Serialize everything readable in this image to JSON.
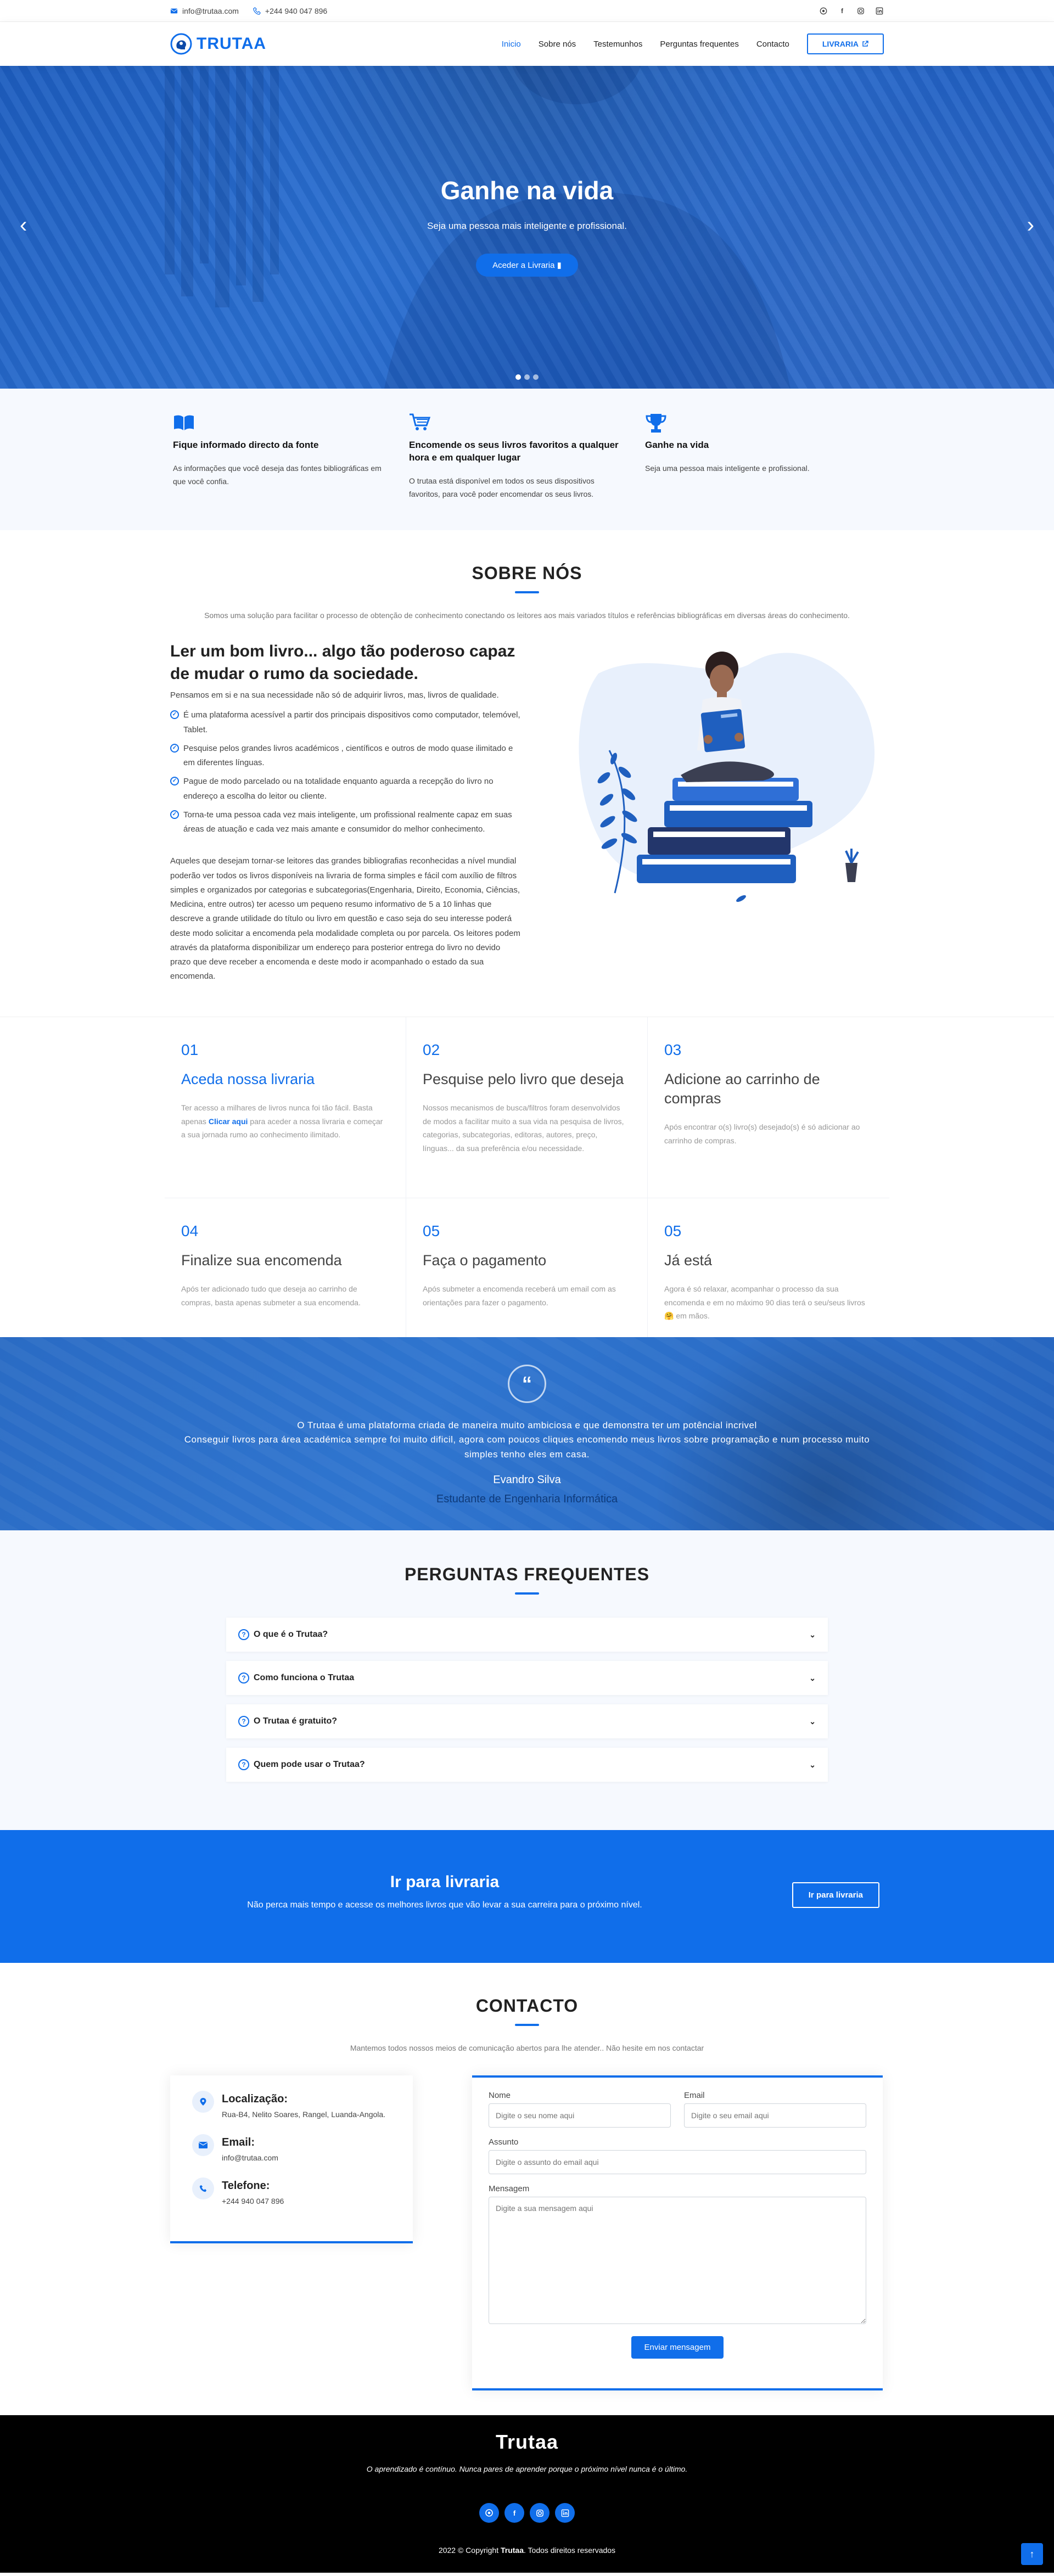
{
  "topbar": {
    "email": "info@trutaa.com",
    "phone": "+244 940 047 896",
    "social_icons": [
      "whatsapp-icon",
      "facebook-icon",
      "instagram-icon",
      "linkedin-icon"
    ]
  },
  "header": {
    "brand": "TRUTAA",
    "nav": [
      "Inicio",
      "Sobre nós",
      "Testemunhos",
      "Perguntas frequentes",
      "Contacto"
    ],
    "active_nav": "Inicio",
    "cta": "LIVRARIA"
  },
  "hero": {
    "title": "Ganhe na vida",
    "subtitle": "Seja uma pessoa mais inteligente e profissional.",
    "button": "Aceder a Livraria",
    "slides": 3,
    "active_slide": 1
  },
  "features": [
    {
      "icon": "book-icon",
      "title": "Fique informado directo da fonte",
      "text": "As informações que você deseja das fontes bibliográficas em que você confia."
    },
    {
      "icon": "cart-icon",
      "title": "Encomende os seus livros favoritos a qualquer hora e em qualquer lugar",
      "text": "O trutaa está disponível em todos os seus dispositivos favoritos, para você poder encomendar os seus livros."
    },
    {
      "icon": "trophy-icon",
      "title": "Ganhe na vida",
      "text": "Seja uma pessoa mais inteligente e profissional."
    }
  ],
  "about": {
    "title": "SOBRE NÓS",
    "subtitle": "Somos uma solução para facilitar o processo de obtenção de conhecimento conectando os leitores aos mais variados títulos e referências bibliográficas em diversas áreas do conhecimento.",
    "heading": "Ler um bom livro... algo tão poderoso capaz de mudar o rumo da sociedade.",
    "lead": "Pensamos em si e na sua necessidade não só de adquirir livros, mas, livros de qualidade.",
    "points": [
      "É uma plataforma acessível a partir dos principais dispositivos como computador, telemóvel, Tablet.",
      "Pesquise pelos grandes livros académicos , científicos e outros de modo quase ilimitado e em diferentes línguas.",
      "Pague de modo parcelado ou na totalidade enquanto aguarda a recepção do livro no endereço a escolha do leitor ou cliente.",
      "Torna-te uma pessoa cada vez mais inteligente, um profissional realmente capaz em suas áreas de atuação e cada vez mais amante e consumidor do melhor conhecimento."
    ],
    "paragraph": "Aqueles que desejam tornar-se leitores das grandes bibliografias reconhecidas a nível mundial poderão ver todos os livros disponíveis na livraria de forma simples e fácil com auxílio de filtros simples e organizados por categorias e subcategorias(Engenharia, Direito, Economia, Ciências, Medicina, entre outros) ter acesso um pequeno resumo informativo de 5 a 10 linhas que descreve a grande utilidade do título ou livro em questão e caso seja do seu interesse poderá deste modo solicitar a encomenda pela modalidade completa ou por parcela. Os leitores podem através da plataforma disponibilizar um endereço para posterior entrega do livro no devido prazo que deve receber a encomenda e deste modo ir acompanhado o estado da sua encomenda."
  },
  "steps": [
    {
      "num": "01",
      "title": "Aceda nossa livraria",
      "text_a": "Ter acesso a milhares de livros nunca foi tão fácil. Basta apenas ",
      "link": "Clicar aqui",
      "text_b": " para aceder a nossa livraria e começar a sua jornada rumo ao conhecimento ilimitado."
    },
    {
      "num": "02",
      "title": "Pesquise pelo livro que deseja",
      "text": "Nossos mecanismos de busca/filtros foram desenvolvidos de modos a facilitar muito a sua vida na pesquisa de livros, categorias, subcategorias, editoras, autores, preço, línguas... da sua preferência e/ou necessidade."
    },
    {
      "num": "03",
      "title": "Adicione ao carrinho de compras",
      "text": "Após encontrar o(s) livro(s) desejado(s) é só adicionar ao carrinho de compras."
    },
    {
      "num": "04",
      "title": "Finalize sua encomenda",
      "text": "Após ter adicionado tudo que deseja ao carrinho de compras, basta apenas submeter a sua encomenda."
    },
    {
      "num": "05",
      "title": "Faça o pagamento",
      "text": "Após submeter a encomenda receberá um email com as orientações para fazer o pagamento."
    },
    {
      "num": "05",
      "title": "Já está",
      "text": "Agora é só relaxar, acompanhar o processo da sua encomenda e em no máximo 90 dias terá o seu/seus livros 🤗 em mãos."
    }
  ],
  "testimonial": {
    "line1": "O Trutaa é uma plataforma criada de maneira muito ambiciosa e que demonstra ter um potêncial incrivel",
    "line2": "Conseguir livros para área académica sempre foi muito dificil, agora com poucos cliques encomendo meus livros sobre programação e num processo muito simples tenho eles em casa.",
    "name": "Evandro Silva",
    "role": "Estudante de Engenharia Informática"
  },
  "faq": {
    "title": "PERGUNTAS FREQUENTES",
    "items": [
      "O que é o Trutaa?",
      "Como funciona o Trutaa",
      "O Trutaa é gratuito?",
      "Quem pode usar o Trutaa?"
    ]
  },
  "cta": {
    "title": "Ir para livraria",
    "text": "Não perca mais tempo e acesse os melhores livros que vão levar a sua carreira para o próximo nível.",
    "button": "Ir para livraria"
  },
  "contact": {
    "title": "CONTACTO",
    "subtitle": "Mantemos todos nossos meios de comunicação abertos para lhe atender.. Não hesite em nos contactar",
    "location_label": "Localização:",
    "location": "Rua-B4, Nelito Soares, Rangel, Luanda-Angola.",
    "email_label": "Email:",
    "email": "info@trutaa.com",
    "phone_label": "Telefone:",
    "phone": "+244 940 047 896",
    "form": {
      "name_label": "Nome",
      "name_placeholder": "Digite o seu nome aqui",
      "email_label": "Email",
      "email_placeholder": "Digite o seu email aqui",
      "subject_label": "Assunto",
      "subject_placeholder": "Digite o assunto do email aqui",
      "message_label": "Mensagem",
      "message_placeholder": "Digite a sua mensagem aqui",
      "submit": "Enviar mensagem"
    }
  },
  "footer": {
    "brand": "Trutaa",
    "tagline": "O aprendizado é contínuo. Nunca pares de aprender porque o próximo nível nunca é o último.",
    "copy_a": "2022 © Copyright ",
    "copy_brand": "Trutaa",
    "copy_b": ". Todos direitos reservados"
  },
  "colors": {
    "primary": "#106eea",
    "footer_bg": "#000000",
    "light_bg": "#f6f9fe"
  }
}
